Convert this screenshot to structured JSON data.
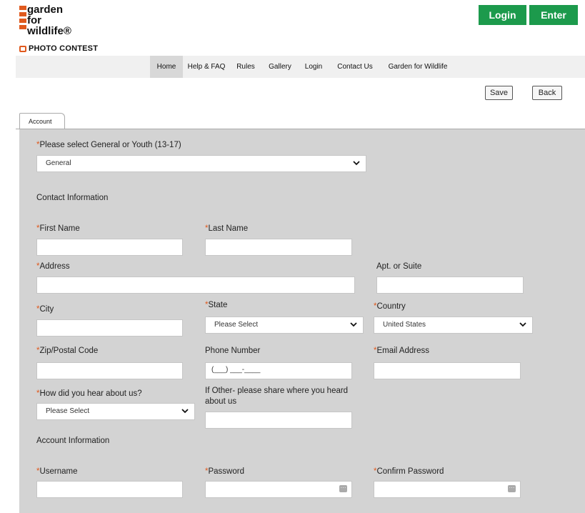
{
  "logo": {
    "lines": [
      "garden",
      "for",
      "wildlife®"
    ],
    "contest": "PHOTO CONTEST",
    "accent": "#e05a1e"
  },
  "header": {
    "login_label": "Login",
    "enter_label": "Enter",
    "button_color": "#1c9a4c"
  },
  "nav": {
    "items": [
      "Home",
      "Help & FAQ",
      "Rules",
      "Gallery",
      "Login",
      "Contact Us",
      "Garden for Wildlife"
    ],
    "active": "Home"
  },
  "toolbar": {
    "save_label": "Save",
    "back_label": "Back"
  },
  "tabs": {
    "account": "Account"
  },
  "form": {
    "category_label": "Please select General or Youth (13-17)",
    "category_value": "General",
    "contact_section": "Contact Information",
    "first_name": "First Name",
    "last_name": "Last Name",
    "address": "Address",
    "apt": "Apt. or Suite",
    "city": "City",
    "state": "State",
    "state_value": "Please Select",
    "country": "Country",
    "country_value": "United States",
    "zip": "Zip/Postal Code",
    "phone": "Phone Number",
    "phone_mask": "(___) ___-____",
    "email": "Email Address",
    "heard": "How did you hear about us?",
    "heard_value": "Please Select",
    "other_line1": "If Other- please share where you heard",
    "other_line2": "about us",
    "account_section": "Account Information",
    "username": "Username",
    "password": "Password",
    "confirm_password": "Confirm Password",
    "required_mark": "*"
  }
}
